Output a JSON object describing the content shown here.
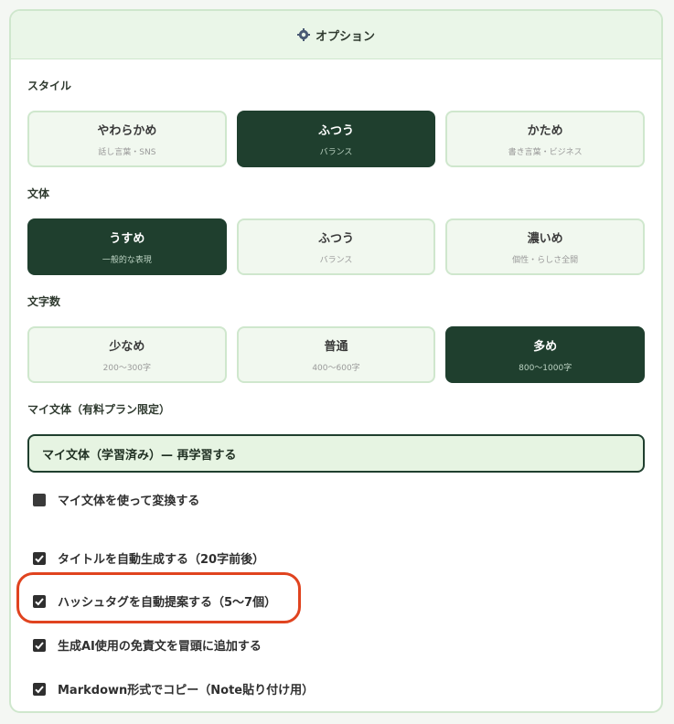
{
  "header": {
    "title": "オプション",
    "icon": "gear-icon"
  },
  "style_section": {
    "label": "スタイル",
    "options": [
      {
        "title": "やわらかめ",
        "sub": "話し言葉・SNS",
        "selected": false
      },
      {
        "title": "ふつう",
        "sub": "バランス",
        "selected": true
      },
      {
        "title": "かため",
        "sub": "書き言葉・ビジネス",
        "selected": false
      }
    ]
  },
  "tone_section": {
    "label": "文体",
    "options": [
      {
        "title": "うすめ",
        "sub": "一般的な表現",
        "selected": true
      },
      {
        "title": "ふつう",
        "sub": "バランス",
        "selected": false
      },
      {
        "title": "濃いめ",
        "sub": "個性・らしさ全開",
        "selected": false
      }
    ]
  },
  "length_section": {
    "label": "文字数",
    "options": [
      {
        "title": "少なめ",
        "sub": "200〜300字",
        "selected": false
      },
      {
        "title": "普通",
        "sub": "400〜600字",
        "selected": false
      },
      {
        "title": "多め",
        "sub": "800〜1000字",
        "selected": true
      }
    ]
  },
  "my_style": {
    "label": "マイ文体（有料プラン限定）",
    "button": "マイ文体（学習済み）— 再学習する",
    "use_checkbox": {
      "label": "マイ文体を使って変換する",
      "checked": false
    }
  },
  "checkboxes": [
    {
      "label": "タイトルを自動生成する（20字前後）",
      "checked": true
    },
    {
      "label": "ハッシュタグを自動提案する（5〜7個）",
      "checked": true
    },
    {
      "label": "生成AI使用の免責文を冒頭に追加する",
      "checked": true
    },
    {
      "label": "Markdown形式でコピー（Note貼り付け用）",
      "checked": true
    }
  ],
  "colors": {
    "accent_dark": "#1f3f2e",
    "light_green": "#f1f8ef",
    "border_green": "#cfe7cd",
    "highlight_red": "#e0431f"
  }
}
